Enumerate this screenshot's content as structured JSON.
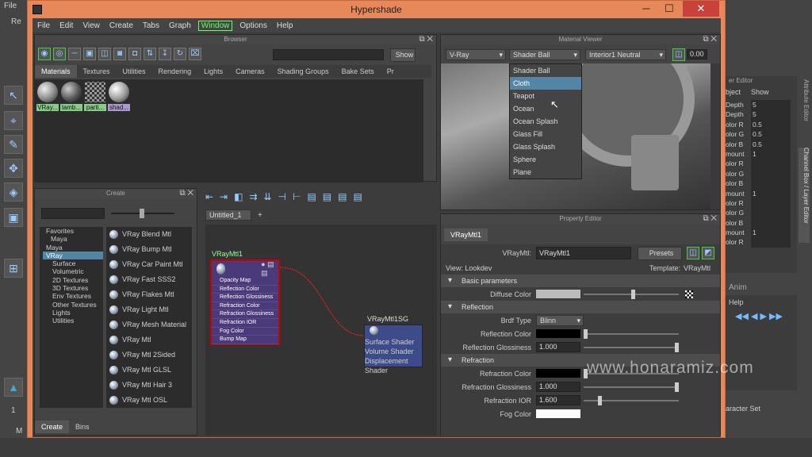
{
  "window": {
    "title": "Hypershade"
  },
  "menu": [
    "File",
    "Edit",
    "View",
    "Create",
    "Tabs",
    "Graph",
    "Window",
    "Options",
    "Help"
  ],
  "browser": {
    "title": "Browser",
    "show_label": "Show",
    "tabs": [
      "Materials",
      "Textures",
      "Utilities",
      "Rendering",
      "Lights",
      "Cameras",
      "Shading Groups",
      "Bake Sets",
      "Pr"
    ],
    "swatches": [
      "VRay...",
      "lamb...",
      "parti...",
      "shad..."
    ]
  },
  "create": {
    "title": "Create",
    "tabs": [
      "Create",
      "Bins"
    ],
    "tree": [
      "Favorites",
      "Maya",
      "Maya",
      "VRay",
      "Surface",
      "Volumetric",
      "2D Textures",
      "3D Textures",
      "Env Textures",
      "Other Textures",
      "Lights",
      "Utilities"
    ],
    "nodes": [
      "VRay Blend Mtl",
      "VRay Bump Mtl",
      "VRay Car Paint Mtl",
      "VRay Fast SSS2",
      "VRay Flakes Mtl",
      "VRay Light Mtl",
      "VRay Mesh Material",
      "VRay Mtl",
      "VRay Mtl 2Sided",
      "VRay Mtl GLSL",
      "VRay Mtl Hair 3",
      "VRay Mtl OSL"
    ]
  },
  "graph": {
    "tab": "Untitled_1",
    "add": "+",
    "node1": {
      "name": "VRayMtl1",
      "attrs": [
        "Opacity Map",
        "Reflection Color",
        "Reflection Glossiness",
        "Refraction Color",
        "Refraction Glossiness",
        "Refraction IOR",
        "Fog Color",
        "Bump Map"
      ]
    },
    "node2": {
      "name": "VRayMtl1SG",
      "attrs": [
        "Surface Shader",
        "Volume Shader",
        "Displacement Shader"
      ]
    }
  },
  "viewer": {
    "title": "Material Viewer",
    "renderer": "V-Ray",
    "shape": "Shader Ball",
    "env": "Interior1 Neutral",
    "exposure": "0.00",
    "options": [
      "Shader Ball",
      "Cloth",
      "Teapot",
      "Ocean",
      "Ocean Splash",
      "Glass Fill",
      "Glass Splash",
      "Sphere",
      "Plane"
    ],
    "selected": "Cloth"
  },
  "props": {
    "title": "Property Editor",
    "tab": "VRayMtl1",
    "name_label": "VRayMtl:",
    "name": "VRayMtl1",
    "presets": "Presets",
    "view": "View: Lookdev",
    "template_label": "Template:",
    "template": "VRayMtl",
    "sections": {
      "basic": "Basic parameters",
      "reflection": "Reflection",
      "refraction": "Refraction"
    },
    "diffuse": "Diffuse Color",
    "brdf": "Brdf Type",
    "brdf_val": "Blinn",
    "refl_color": "Reflection Color",
    "refl_gloss": "Reflection Glossiness",
    "refl_gloss_val": "1.000",
    "refr_color": "Refraction Color",
    "refr_gloss": "Refraction Glossiness",
    "refr_gloss_val": "1.000",
    "refr_ior": "Refraction IOR",
    "refr_ior_val": "1.600",
    "fog": "Fog Color"
  },
  "right": {
    "editor": "er Editor",
    "object": "bject",
    "show": "Show",
    "attrs": [
      "Depth",
      "Depth",
      "olor R",
      "olor G",
      "olor B",
      "mount",
      "olor R",
      "olor G",
      "olor B",
      "mount",
      "olor R",
      "olor G",
      "olor B",
      "mount",
      "olor R"
    ],
    "vals": [
      "5",
      "5",
      "0.5",
      "0.5",
      "0.5",
      "1",
      "",
      "",
      "",
      "1",
      "",
      "",
      "",
      "1",
      ""
    ],
    "anim": "Anim",
    "help": "Help",
    "charset": "aracter Set",
    "side1": "Attribute Editor",
    "side2": "Channel Box / Layer Editor"
  },
  "left": {
    "file": "File",
    "re": "Re",
    "num": "1",
    "m": "M"
  },
  "watermark": "www.honaramiz.com"
}
